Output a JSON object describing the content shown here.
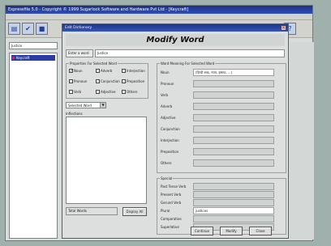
{
  "app": {
    "title": "Expressfile 5.0 - Copyright © 1999 Sugarlock Software and Hardware Pvt Ltd - [Keycraft]",
    "left_input_value": "Justice",
    "left_selected_item": "Keycraft"
  },
  "dialog": {
    "title": "Edit Dictionary",
    "close_glyph": "×",
    "heading": "Modify Word",
    "word_label": "Enter a word",
    "word_value": "Justice",
    "properties_title": "Properties For Selected Word",
    "properties": [
      {
        "label": "Noun",
        "checked": true
      },
      {
        "label": "Adverb",
        "checked": false
      },
      {
        "label": "Interjection",
        "checked": false
      },
      {
        "label": "Pronoun",
        "checked": false
      },
      {
        "label": "Conjunction",
        "checked": false
      },
      {
        "label": "Preposition",
        "checked": false
      },
      {
        "label": "Verb",
        "checked": false
      },
      {
        "label": "Adjective",
        "checked": false
      },
      {
        "label": "Others",
        "checked": false
      }
    ],
    "combo_value": "Selected Word",
    "inflections_label": "Inflections",
    "total_label": "Total Words",
    "display_button": "Display All",
    "meanings_title": "Word Meaning For Selected Word",
    "meanings": [
      {
        "label": "Noun",
        "value": "(हिन्दी शब्द, न्याय, इंसाफ़, ...)"
      },
      {
        "label": "Pronoun",
        "value": ""
      },
      {
        "label": "Verb",
        "value": ""
      },
      {
        "label": "Adverb",
        "value": ""
      },
      {
        "label": "Adjective",
        "value": ""
      },
      {
        "label": "Conjunction",
        "value": ""
      },
      {
        "label": "Interjection",
        "value": ""
      },
      {
        "label": "Preposition",
        "value": ""
      },
      {
        "label": "Others",
        "value": ""
      }
    ],
    "special_title": "Special",
    "special": [
      {
        "label": "Past Tense Verb",
        "value": ""
      },
      {
        "label": "Present Verb",
        "value": ""
      },
      {
        "label": "Gerund Verb",
        "value": ""
      },
      {
        "label": "Plural",
        "value": "justices"
      },
      {
        "label": "Comparative",
        "value": ""
      },
      {
        "label": "Superlative",
        "value": ""
      }
    ],
    "buttons": {
      "continue": "Continue",
      "modify": "Modify",
      "close": "Close"
    }
  }
}
